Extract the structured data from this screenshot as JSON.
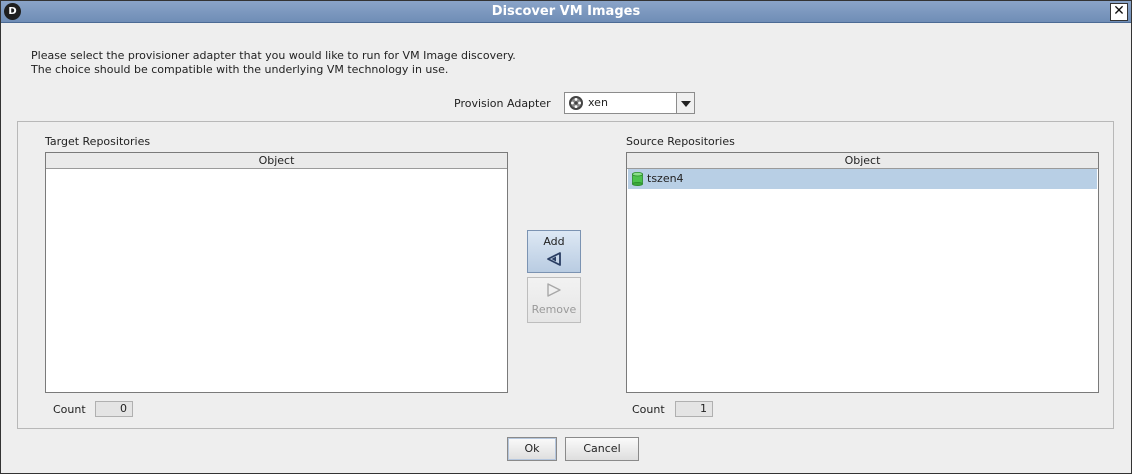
{
  "window": {
    "title": "Discover VM Images",
    "close_glyph": "✕",
    "app_icon_letter": "D"
  },
  "instructions": {
    "line1": "Please select the provisioner adapter that you would like to run for VM Image discovery.",
    "line2": "The choice should be compatible with the underlying VM technology in use."
  },
  "adapter": {
    "label": "Provision Adapter",
    "selected": "xen",
    "icon": "gear-icon"
  },
  "target": {
    "title": "Target Repositories",
    "column": "Object",
    "rows": [],
    "count_label": "Count",
    "count": "0"
  },
  "source": {
    "title": "Source Repositories",
    "column": "Object",
    "rows": [
      {
        "label": "tszen4",
        "icon": "database-icon",
        "selected": true
      }
    ],
    "count_label": "Count",
    "count": "1"
  },
  "transfer": {
    "add_label": "Add",
    "remove_label": "Remove"
  },
  "footer": {
    "ok_label": "Ok",
    "cancel_label": "Cancel"
  },
  "colors": {
    "titlebar": "#7b97bf",
    "selection": "#b8cfe5",
    "db_icon": "#4cc24c"
  }
}
